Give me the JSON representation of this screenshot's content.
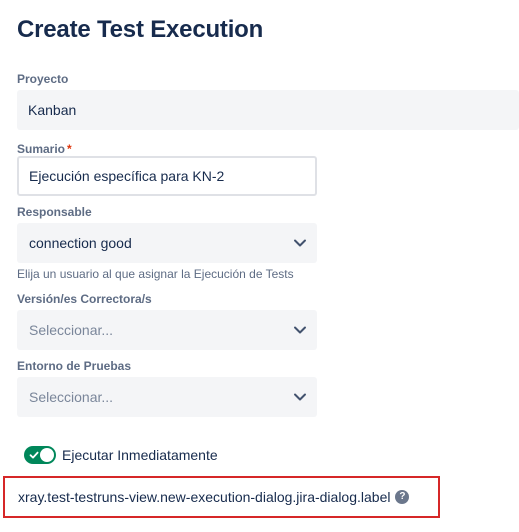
{
  "dialog": {
    "title": "Create Test Execution"
  },
  "fields": {
    "project": {
      "label": "Proyecto",
      "value": "Kanban"
    },
    "summary": {
      "label": "Sumario",
      "required_mark": "*",
      "value": "Ejecución específica para KN-2"
    },
    "assignee": {
      "label": "Responsable",
      "value": "connection good",
      "helper": "Elija un usuario al que asignar la Ejecución de Tests"
    },
    "fix_version": {
      "label": "Versión/es Correctora/s",
      "placeholder": "Seleccionar..."
    },
    "test_environment": {
      "label": "Entorno de Pruebas",
      "placeholder": "Seleccionar..."
    }
  },
  "execute_now": {
    "label": "Ejecutar Inmediatamente",
    "enabled": true
  },
  "jira_dialog": {
    "label": "xray.test-testruns-view.new-execution-dialog.jira-dialog.label",
    "help_icon": "?"
  },
  "colors": {
    "toggle_on": "#00875a",
    "required": "#de350b",
    "highlight_border": "#d62728"
  },
  "icons": {
    "dropdown": "chevron-down-icon",
    "toggle_check": "check-icon",
    "help": "question-circle-icon"
  }
}
